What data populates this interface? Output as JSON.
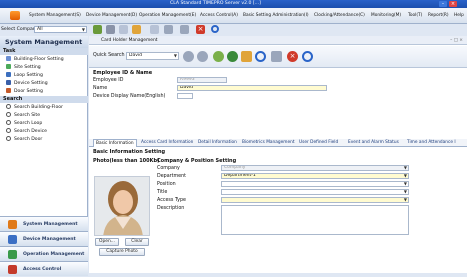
{
  "window": {
    "title": "CLA Standard TIMEPRO Server v2.0 [...]"
  },
  "menu": [
    "System Management(S)",
    "Device Management(D)",
    "Operation Management(E)",
    "Access Control(A)",
    "Basic Setting Administration(I)",
    "Clocking/Attendance(C)",
    "Monitoring(M)",
    "Tool(T)",
    "Report(R)",
    "Help"
  ],
  "company": {
    "label": "Select Company",
    "value": "All"
  },
  "left_panel": {
    "title": "System Management",
    "task_label": "Task",
    "tasks": [
      "Building-Floor Setting",
      "Site Setting",
      "Loop Setting",
      "Device Setting",
      "Door Setting"
    ],
    "search_label": "Search",
    "searches": [
      "Search Building-Floor",
      "Search Site",
      "Search Loop",
      "Search Device",
      "Search Door"
    ],
    "nav": [
      "System Management",
      "Device Management",
      "Operation Management",
      "Access Control"
    ]
  },
  "main": {
    "window_title": "Card Holder Management",
    "quick_search_label": "Quick Search",
    "quick_search_value": "David",
    "section_id": "Employee ID & Name",
    "employee_id_label": "Employee ID",
    "employee_id_value": "R9993",
    "name_label": "Name",
    "name_value": "David",
    "display_label": "Device Display Name(English)",
    "tabs": [
      "Basic Information",
      "Access Card Information",
      "Detail Information",
      "Biometrics Management",
      "User Defined Field",
      "Event and Alarm Status",
      "Time and Attendance I"
    ],
    "basic_setting": "Basic Information Setting",
    "photo_label": "Photo(less than 100Kb)",
    "company_pos_label": "Company & Position Setting",
    "fields": {
      "company_label": "Company",
      "company_value": "Company",
      "department_label": "Department",
      "department_value": "Department-1",
      "position_label": "Position",
      "title_label": "Title",
      "access_type_label": "Access Type",
      "description_label": "Description"
    },
    "open_btn": "Open...",
    "clear_btn": "Clear",
    "capture_btn": "Capture Photo"
  }
}
